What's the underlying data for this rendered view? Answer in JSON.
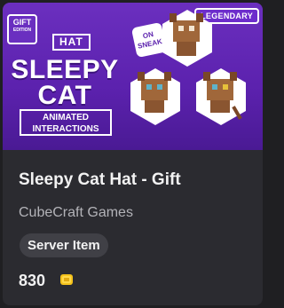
{
  "banner": {
    "gift_badge_line1": "GIFT",
    "gift_badge_line2": "EDITION",
    "rarity": "LEGENDARY",
    "category_tag": "HAT",
    "title_line1": "SLEEPY",
    "title_line2": "CAT",
    "feature_line1": "ANIMATED",
    "feature_line2": "INTERACTIONS",
    "sneak_line1": "ON",
    "sneak_line2": "SNEAK"
  },
  "item": {
    "title": "Sleepy Cat Hat - Gift",
    "publisher": "CubeCraft Games",
    "chip": "Server Item",
    "price": "830"
  },
  "colors": {
    "banner_purple": "#5b21ad",
    "card_bg": "#2b2b30",
    "coin_gold": "#f4c21b"
  },
  "icons": {
    "price": "minecoin-icon"
  }
}
